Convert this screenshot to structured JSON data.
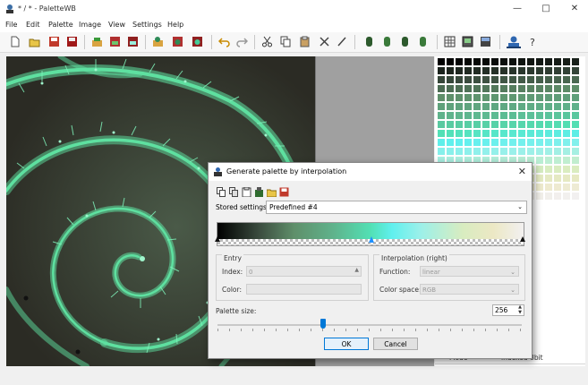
{
  "window": {
    "title": "* / * - PaletteWB",
    "min": "—",
    "max": "□",
    "close": "✕"
  },
  "menu": [
    "File",
    "Edit",
    "Palette",
    "Image",
    "View",
    "Settings",
    "Help"
  ],
  "toolbar_icons": [
    "new-icon",
    "open-icon",
    "save-icon",
    "save-as-icon",
    "import-palette-icon",
    "save-palette-icon",
    "save-palette-as-icon",
    "open-image-icon",
    "save-image-icon",
    "save-image-as-icon",
    "undo-icon",
    "redo-icon",
    "cut-icon",
    "copy-icon",
    "paste-icon",
    "delete-icon",
    "pencil-icon",
    "tool1-icon",
    "tool2-icon",
    "tool3-icon",
    "tool4-icon",
    "grid-icon",
    "image-view-icon",
    "gradient-icon",
    "user-icon",
    "help-icon"
  ],
  "palette_panel": {
    "properties": [
      {
        "key": "",
        "value": ""
      },
      {
        "key": "",
        "value": ""
      },
      {
        "key": "",
        "value": ""
      },
      {
        "key": "",
        "value": ""
      },
      {
        "key": "",
        "value": ""
      },
      {
        "key": "",
        "value": ""
      },
      {
        "key": "",
        "value": ""
      },
      {
        "key": "",
        "value": ""
      },
      {
        "key": "",
        "value": ""
      },
      {
        "key": "",
        "value": ""
      },
      {
        "key": "Mode",
        "value": "indexed 8bit"
      }
    ]
  },
  "dialog": {
    "title": "Generate palette by interpolation",
    "close": "✕",
    "stored_settings_label": "Stored settings:",
    "stored_settings_value": "Predefined #4",
    "entry_group": "Entry",
    "index_label": "Index:",
    "index_value": "0",
    "color_label": "Color:",
    "interp_group": "Interpolation (right)",
    "function_label": "Function:",
    "function_value": "linear",
    "colorspace_label": "Color space:",
    "colorspace_value": "RGB",
    "palette_size_label": "Palette size:",
    "palette_size_value": "256",
    "palette_size_fraction": 0.345,
    "ok": "OK",
    "cancel": "Cancel"
  },
  "colors": {
    "accent": "#0078d7",
    "fractal_green": "#5ee0a0",
    "background": "#2e2e26"
  }
}
